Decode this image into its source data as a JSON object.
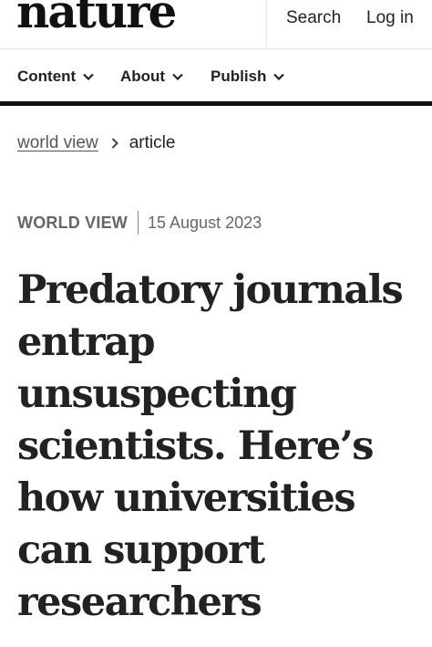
{
  "header": {
    "logo": "nature",
    "search_label": "Search",
    "login_label": "Log in"
  },
  "nav": {
    "items": [
      {
        "label": "Content",
        "icon": "chevron-down-icon"
      },
      {
        "label": "About",
        "icon": "chevron-down-icon"
      },
      {
        "label": "Publish",
        "icon": "chevron-down-icon"
      }
    ]
  },
  "breadcrumb": {
    "parent": "world view",
    "separator_icon": "chevron-right-icon",
    "current": "article"
  },
  "article": {
    "type": "WORLD VIEW",
    "date": "15 August 2023",
    "title": "Predatory journals entrap unsuspecting scientists. Here’s how universities can support researchers"
  },
  "colors": {
    "text": "#222222",
    "muted": "#666666",
    "rule": "#111111"
  }
}
